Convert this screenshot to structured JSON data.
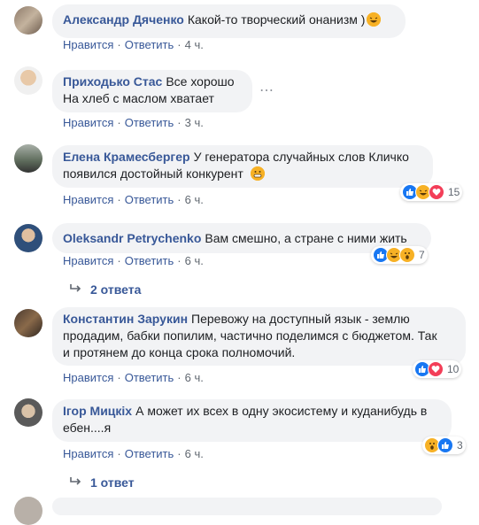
{
  "comments": [
    {
      "author": "Александр Дяченко",
      "text": "Какой-то творческий онанизм )",
      "like": "Нравится",
      "reply": "Ответить",
      "time": "4 ч."
    },
    {
      "author": "Приходько Стас",
      "text_line1": "Все хорошо",
      "text_line2": "На хлеб с маслом хватает",
      "like": "Нравится",
      "reply": "Ответить",
      "time": "3 ч."
    },
    {
      "author": "Елена Крамесбергер",
      "text_line1": "У генератора случайных слов Кличко",
      "text_line2": "появился достойный конкурент",
      "like": "Нравится",
      "reply": "Ответить",
      "time": "6 ч.",
      "reaction_count": "15"
    },
    {
      "author": "Oleksandr Petrychenko",
      "text": "Вам смешно, а стране с ними жить",
      "like": "Нравится",
      "reply": "Ответить",
      "time": "6 ч.",
      "reaction_count": "7",
      "replies": "2 ответа"
    },
    {
      "author": "Константин Зарукин",
      "text_line1": "Перевожу на доступный язык - землю",
      "text_line2": "продадим, бабки попилим, частично поделимся с бюджетом. Так",
      "text_line3": "и протянем до конца срока полномочий.",
      "like": "Нравится",
      "reply": "Ответить",
      "time": "6 ч.",
      "reaction_count": "10"
    },
    {
      "author": "Ігор Мицкіх",
      "text_line1": "А может их всех в одну экосистему и куданибудь в",
      "text_line2": "ебен....я",
      "like": "Нравится",
      "reply": "Ответить",
      "time": "6 ч.",
      "reaction_count": "3",
      "replies": "1 ответ"
    }
  ],
  "icons": {
    "like": "like-icon",
    "love": "love-icon",
    "haha": "haha-icon",
    "wow": "wow-icon",
    "reply_arrow": "reply-arrow-icon"
  },
  "colors": {
    "link": "#385898",
    "bubble": "#f2f3f5",
    "meta": "#606770",
    "like": "#1877f2",
    "love": "#f33e58",
    "haha": "#f7b125"
  }
}
